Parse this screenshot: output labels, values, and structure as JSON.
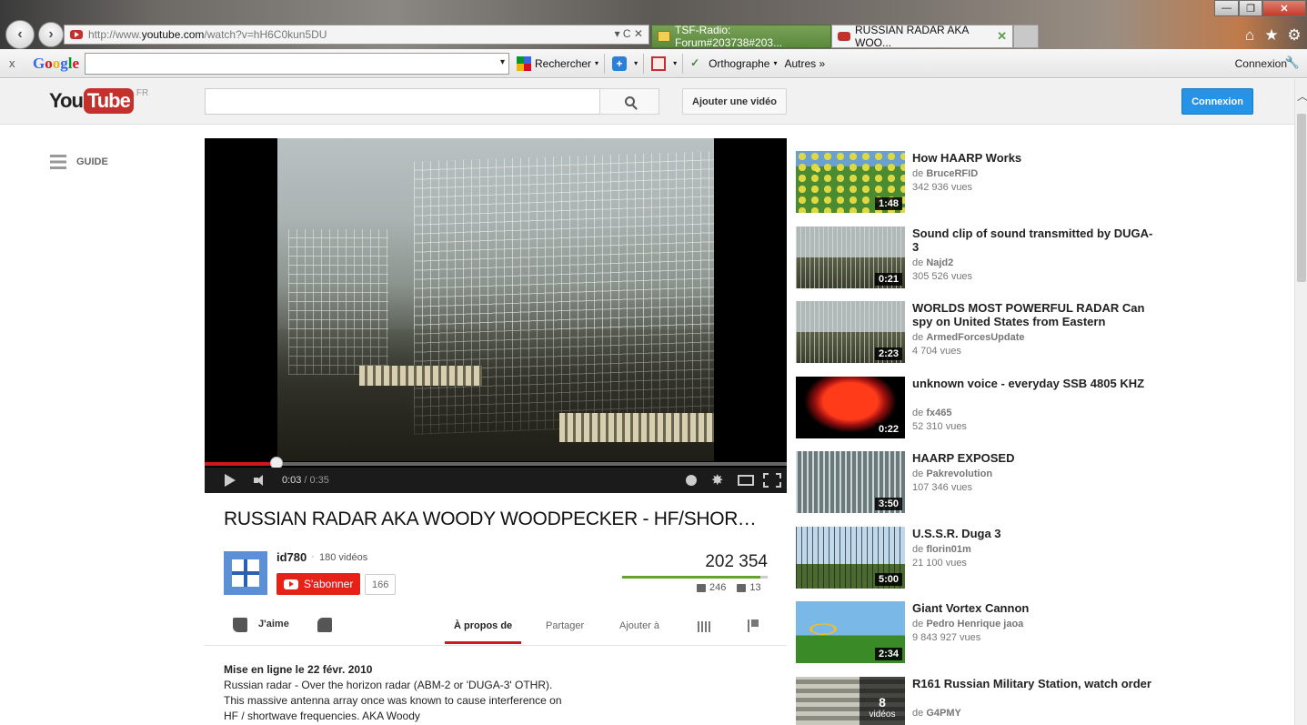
{
  "browser": {
    "url_prefix": "http://www.",
    "url_domain": "youtube.com",
    "url_path": "/watch?v=hH6C0kun5DU",
    "address_controls": "▾ C ✕",
    "tabs": [
      {
        "title": "TSF-Radio: Forum#203738#203...",
        "active": false
      },
      {
        "title": "RUSSIAN RADAR AKA WOO...",
        "active": true
      }
    ],
    "tab_close": "✕",
    "window_buttons": {
      "minimize": "—",
      "maximize": "❐",
      "close": "✕"
    },
    "icons": {
      "home": "⌂",
      "favorites": "★",
      "tools": "⚙"
    }
  },
  "toolbar": {
    "close": "x",
    "google_logo": [
      "G",
      "o",
      "o",
      "g",
      "l",
      "e"
    ],
    "search_value": "",
    "search_dropdown": "▾",
    "rechercher": "Rechercher",
    "orthographe": "Orthographe",
    "autres": "Autres »",
    "connexion": "Connexion",
    "caret": "▾",
    "wrench": "🔧"
  },
  "header": {
    "logo_you": "You",
    "logo_tube": "Tube",
    "country": "FR",
    "search_placeholder": "",
    "upload_label": "Ajouter une vidéo",
    "signin_label": "Connexion"
  },
  "guide_label": "GUIDE",
  "player": {
    "current_time": "0:03",
    "separator": "/",
    "duration": "0:35",
    "progress_fraction": 0.1227,
    "settings_glyph": "✸"
  },
  "video": {
    "title": "RUSSIAN RADAR AKA WOODY WOODPECKER - HF/SHORTWAVE INTERFERENCE",
    "channel": "id780",
    "channel_sep": "·",
    "channel_videos": "180 vidéos",
    "subscribe_label": "S'abonner",
    "subscribers": "166",
    "views": "202 354",
    "likes": "246",
    "dislikes": "13",
    "like_fraction": 0.95,
    "like_label": "J'aime",
    "tabs": {
      "about": "À propos de",
      "share": "Partager",
      "add_to": "Ajouter à"
    },
    "upload_date": "Mise en ligne le 22 févr. 2010",
    "description": "Russian radar - Over the horizon radar (ABM-2 or 'DUGA-3' OTHR). This massive antenna array once was known to cause interference on HF / shortwave frequencies. AKA Woody"
  },
  "related": [
    {
      "title": "How HAARP Works",
      "by": "de",
      "channel": "BruceRFID",
      "views": "342 936 vues",
      "duration": "1:48",
      "thumb": "haarp"
    },
    {
      "title": "Sound clip of sound transmitted by DUGA-3",
      "by": "de",
      "channel": "Najd2",
      "views": "305 526 vues",
      "duration": "0:21",
      "thumb": "duga"
    },
    {
      "title": "WORLDS MOST POWERFUL RADAR Can spy on United States from Eastern",
      "by": "de",
      "channel": "ArmedForcesUpdate",
      "views": "4 704 vues",
      "duration": "2:23",
      "thumb": "duga"
    },
    {
      "title": "unknown voice - everyday SSB 4805 KHZ",
      "by": "de",
      "channel": "fx465",
      "views": "52 310 vues",
      "duration": "0:22",
      "thumb": "red"
    },
    {
      "title": "HAARP EXPOSED",
      "by": "de",
      "channel": "Pakrevolution",
      "views": "107 346 vues",
      "duration": "3:50",
      "thumb": "haarp2"
    },
    {
      "title": "U.S.S.R. Duga 3",
      "by": "de",
      "channel": "florin01m",
      "views": "21 100 vues",
      "duration": "5:00",
      "thumb": "ussr"
    },
    {
      "title": "Giant Vortex Cannon",
      "by": "de",
      "channel": "Pedro Henrique jaoa",
      "views": "9 843 927 vues",
      "duration": "2:34",
      "thumb": "vortex"
    },
    {
      "title": "R161 Russian Military Station, watch order",
      "by": "de",
      "channel": "G4PMY",
      "views": "",
      "playlist_count": "8",
      "playlist_label": "vidéos",
      "thumb": "station"
    }
  ]
}
